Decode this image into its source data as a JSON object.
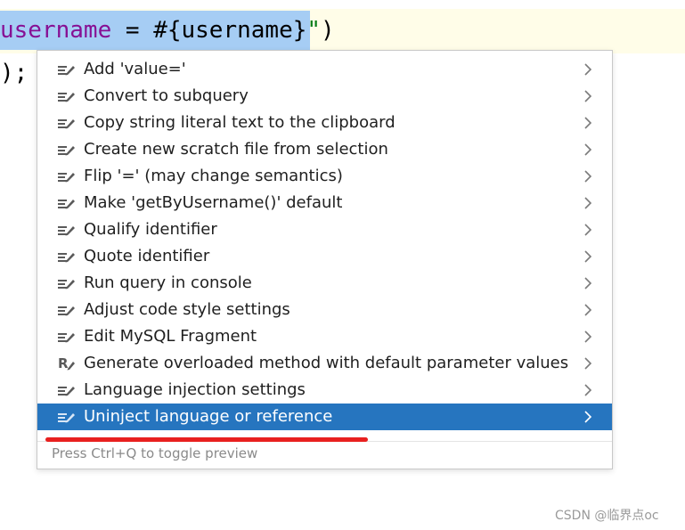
{
  "editor": {
    "line1": {
      "var": "username",
      "op": " = #{username}",
      "quote": "\"",
      "paren": ")"
    },
    "line2": ");"
  },
  "menu": {
    "items": [
      {
        "label": "Add 'value='",
        "icon": "intention-bulb-icon"
      },
      {
        "label": "Convert to subquery",
        "icon": "intention-bulb-icon"
      },
      {
        "label": "Copy string literal text to the clipboard",
        "icon": "intention-bulb-icon"
      },
      {
        "label": "Create new scratch file from selection",
        "icon": "intention-bulb-icon"
      },
      {
        "label": "Flip '=' (may change semantics)",
        "icon": "intention-bulb-icon"
      },
      {
        "label": "Make 'getByUsername()' default",
        "icon": "intention-bulb-icon"
      },
      {
        "label": "Qualify identifier",
        "icon": "intention-bulb-icon"
      },
      {
        "label": "Quote identifier",
        "icon": "intention-bulb-icon"
      },
      {
        "label": "Run query in console",
        "icon": "intention-bulb-icon"
      },
      {
        "label": "Adjust code style settings",
        "icon": "intention-bulb-icon"
      },
      {
        "label": "Edit MySQL Fragment",
        "icon": "intention-bulb-icon"
      },
      {
        "label": "Generate overloaded method with default parameter values",
        "icon": "kotlin-refactor-icon"
      },
      {
        "label": "Language injection settings",
        "icon": "intention-bulb-icon"
      },
      {
        "label": "Uninject language or reference",
        "icon": "intention-bulb-icon",
        "selected": true
      }
    ],
    "footer": "Press Ctrl+Q to toggle preview"
  },
  "watermark": "CSDN @临界点oc",
  "colors": {
    "selection_bg": "#2675bf",
    "editor_highlight": "#a6cdf4",
    "annotation_red": "#e8201f"
  }
}
